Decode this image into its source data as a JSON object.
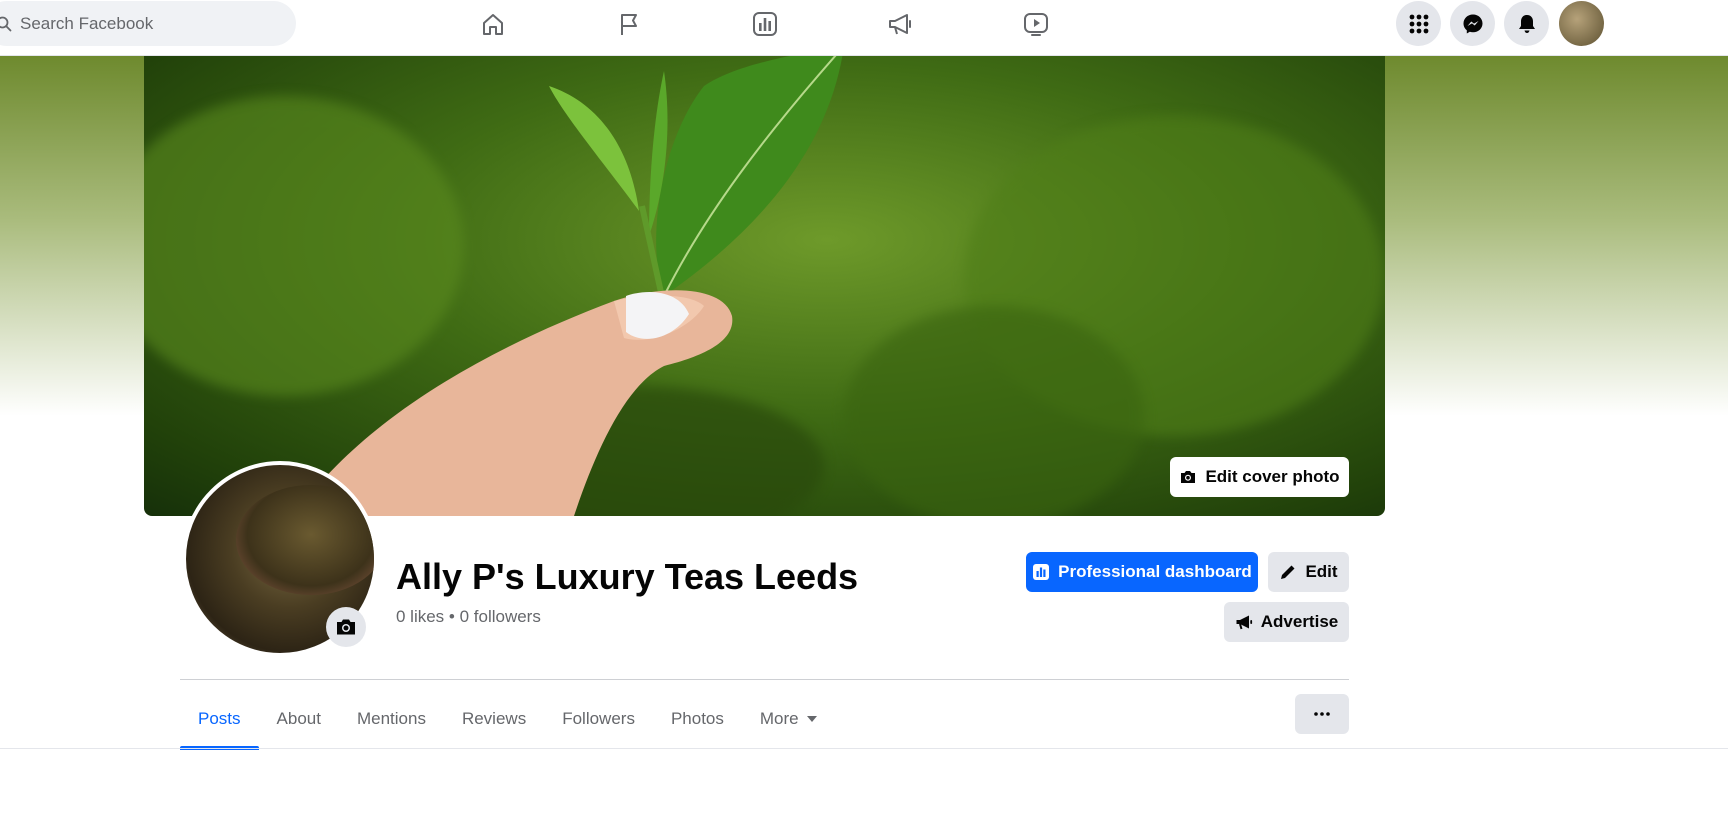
{
  "header": {
    "search_placeholder": "Search Facebook",
    "nav_icons": [
      "home-icon",
      "flag-icon",
      "insights-icon",
      "megaphone-icon",
      "video-icon"
    ],
    "right_icons": [
      "menu-grid-icon",
      "messenger-icon",
      "bell-icon"
    ]
  },
  "cover": {
    "edit_label": "Edit cover photo"
  },
  "profile": {
    "name": "Ally P's Luxury Teas Leeds",
    "stats": "0 likes • 0 followers"
  },
  "actions": {
    "dashboard_label": "Professional dashboard",
    "edit_label": "Edit",
    "advertise_label": "Advertise"
  },
  "tabs": [
    {
      "label": "Posts",
      "active": true
    },
    {
      "label": "About"
    },
    {
      "label": "Mentions"
    },
    {
      "label": "Reviews"
    },
    {
      "label": "Followers"
    },
    {
      "label": "Photos"
    },
    {
      "label": "More"
    }
  ],
  "colors": {
    "accent": "#0866ff",
    "secondary_bg": "#e4e6eb",
    "muted_text": "#65676b"
  }
}
